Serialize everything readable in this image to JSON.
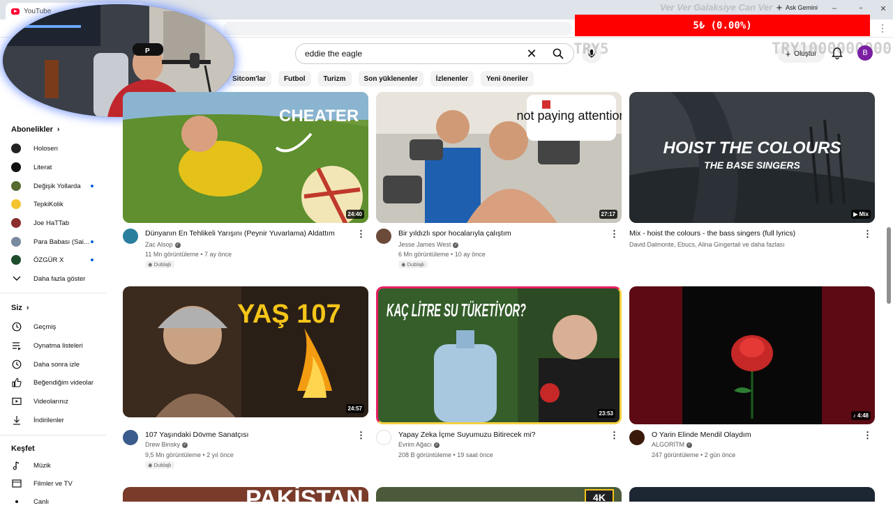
{
  "browser": {
    "tab_title": "YouTube",
    "ask_gemini": "Ask Gemini",
    "overlay_marquee": "Ver Ver Galaksiye Can Ver",
    "donation_bar": "5₺ (0.00%)",
    "overlay_try5": "TRY5",
    "overlay_trybig": "TRY1000000000"
  },
  "header": {
    "search_value": "eddie the eagle",
    "create_label": "Oluştur",
    "profile_initial": "B"
  },
  "chips": [
    "Sitcom'lar",
    "Futbol",
    "Turizm",
    "Son yüklenenler",
    "İzlenenler",
    "Yeni öneriler"
  ],
  "sidebar": {
    "subs_title": "Abonelikler",
    "subs": [
      {
        "label": "Holosen",
        "color": "#222222",
        "new": false
      },
      {
        "label": "Literat",
        "color": "#111111",
        "new": false
      },
      {
        "label": "Değişik Yollarda",
        "color": "#556b2f",
        "new": true
      },
      {
        "label": "TepkiKolik",
        "color": "#f4c430",
        "new": false
      },
      {
        "label": "Joe HaTTab",
        "color": "#8b2d2d",
        "new": false
      },
      {
        "label": "Para Babası (Sai...",
        "color": "#7a8aa0",
        "new": true
      },
      {
        "label": "ÖZGÜR X",
        "color": "#1f4d2b",
        "new": true
      }
    ],
    "show_more": "Daha fazla göster",
    "you_title": "Siz",
    "you_items": [
      "Geçmiş",
      "Oynatma listeleri",
      "Daha sonra izle",
      "Beğendiğim videolar",
      "Videolarınız",
      "İndirilenler"
    ],
    "explore_title": "Keşfet",
    "explore_items": [
      "Müzik",
      "Filmler ve TV",
      "Canlı"
    ]
  },
  "videos": [
    {
      "title": "Dünyanın En Tehlikeli Yarışını (Peynir Yuvarlama) Aldattım",
      "channel": "Zac Alsop",
      "verified": true,
      "meta": "11 Mn görüntüleme • 7 ay önce",
      "badge": "Dublajlı",
      "duration": "24:40",
      "thumb_text": "CHEATER",
      "avatar_color": "#2a7f9e"
    },
    {
      "title": "Bir yıldızlı spor hocalarıyla çalıştım",
      "channel": "Jesse James West",
      "verified": true,
      "meta": "6 Mn görüntüleme • 10 ay önce",
      "badge": "Dublajlı",
      "duration": "27:17",
      "thumb_text": "not paying attention",
      "avatar_color": "#6b4a3a"
    },
    {
      "title": "Mix - hoist the colours - the bass singers (full lyrics)",
      "channel": "David Dalmonte, Ebucs, Alina Gingertail ve daha fazlası",
      "verified": false,
      "meta": "",
      "badge": "",
      "duration": "Mix",
      "thumb_text": "HOIST THE COLOURS",
      "thumb_sub": "THE BASE SINGERS",
      "avatar_color": ""
    },
    {
      "title": "107 Yaşındaki Dövme Sanatçısı",
      "channel": "Drew Binsky",
      "verified": true,
      "meta": "9,5 Mn görüntüleme • 2 yıl önce",
      "badge": "Dublajlı",
      "duration": "24:57",
      "thumb_text": "YAŞ 107",
      "avatar_color": "#3b5b8c"
    },
    {
      "title": "Yapay Zeka İçme Suyumuzu Bitirecek mi?",
      "channel": "Evrim Ağacı",
      "verified": true,
      "meta": "208 B görüntüleme • 19 saat önce",
      "badge": "",
      "duration": "23:53",
      "thumb_text": "KAÇ LİTRE SU TÜKETİYOR?",
      "avatar_color": "#ffffff"
    },
    {
      "title": "O Yarin Elinde Mendil Olaydım",
      "channel": "ALGORİTM",
      "verified": true,
      "meta": "247 görüntüleme • 2 gün önce",
      "badge": "",
      "duration": "4:48",
      "thumb_text": "",
      "avatar_color": "#3a1a0a"
    }
  ],
  "bottom_row": {
    "thumb1_text": "PAKİSTAN",
    "thumb2_badge": "4K"
  }
}
